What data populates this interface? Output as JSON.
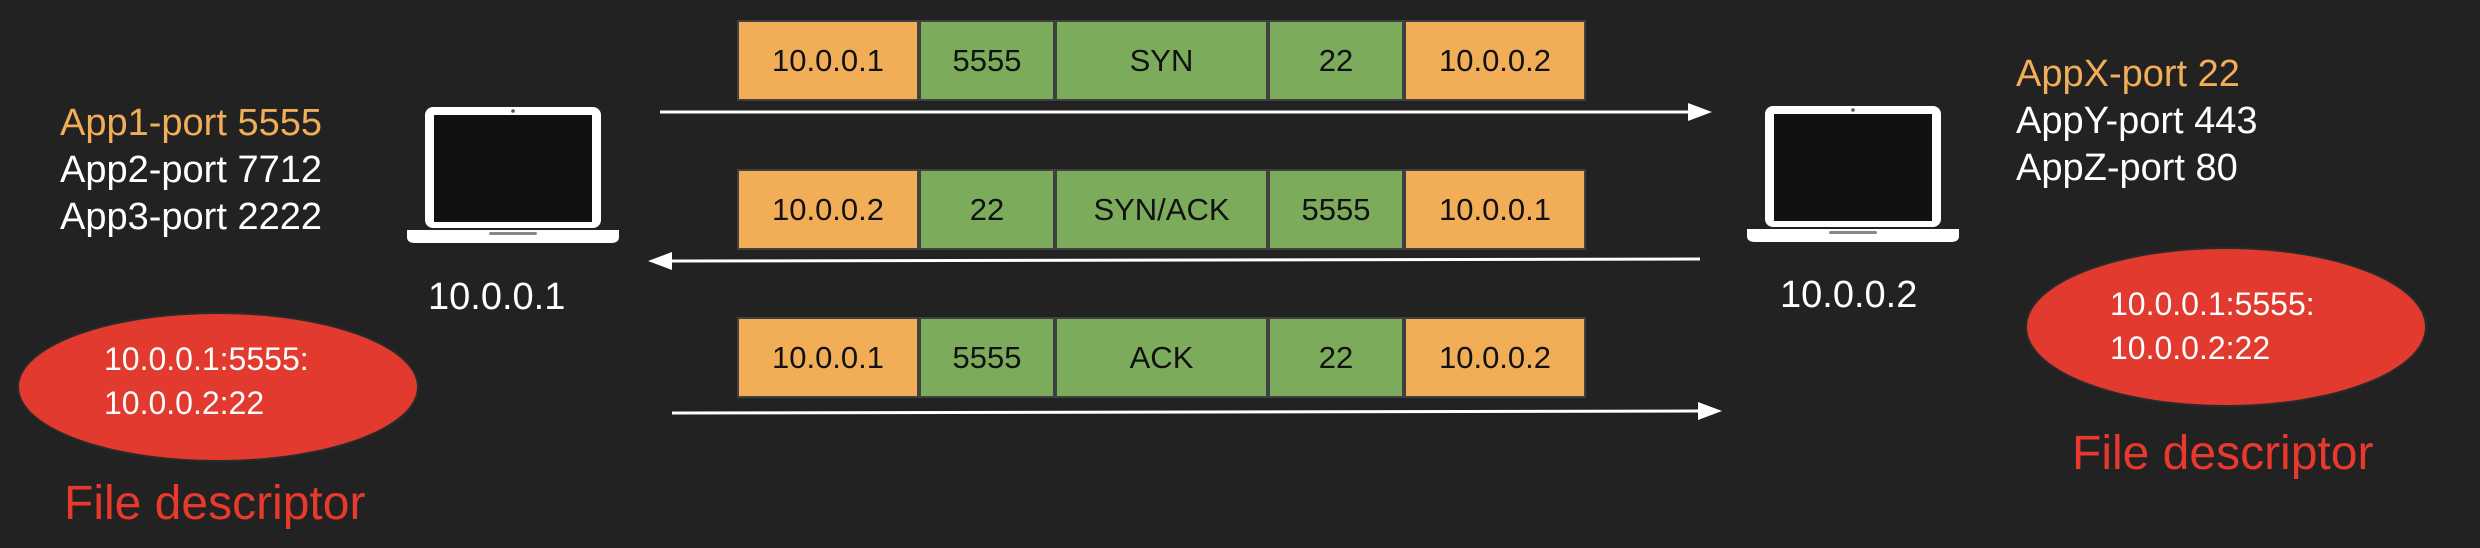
{
  "left_host": {
    "apps": [
      "App1-port 5555",
      "App2-port 7712",
      "App3-port 2222"
    ],
    "ip": "10.0.0.1",
    "fd_lines": [
      "10.0.0.1:5555:",
      "10.0.0.2:22"
    ],
    "fd_label": "File descriptor"
  },
  "right_host": {
    "apps": [
      "AppX-port 22",
      "AppY-port 443",
      "AppZ-port 80"
    ],
    "ip": "10.0.0.2",
    "fd_lines": [
      "10.0.0.1:5555:",
      "10.0.0.2:22"
    ],
    "fd_label": "File descriptor"
  },
  "packets": [
    {
      "src_ip": "10.0.0.1",
      "src_port": "5555",
      "flag": "SYN",
      "dst_port": "22",
      "dst_ip": "10.0.0.2",
      "direction": "right"
    },
    {
      "src_ip": "10.0.0.2",
      "src_port": "22",
      "flag": "SYN/ACK",
      "dst_port": "5555",
      "dst_ip": "10.0.0.1",
      "direction": "left"
    },
    {
      "src_ip": "10.0.0.1",
      "src_port": "5555",
      "flag": "ACK",
      "dst_port": "22",
      "dst_ip": "10.0.0.2",
      "direction": "right"
    }
  ],
  "colors": {
    "background": "#222222",
    "ip_field": "#f2ae57",
    "port_field": "#7cab5c",
    "fd_ellipse": "#e23a2e",
    "fd_label": "#e8392c",
    "highlight_app": "#f2ae57"
  },
  "icons": {
    "host": "laptop-icon"
  }
}
